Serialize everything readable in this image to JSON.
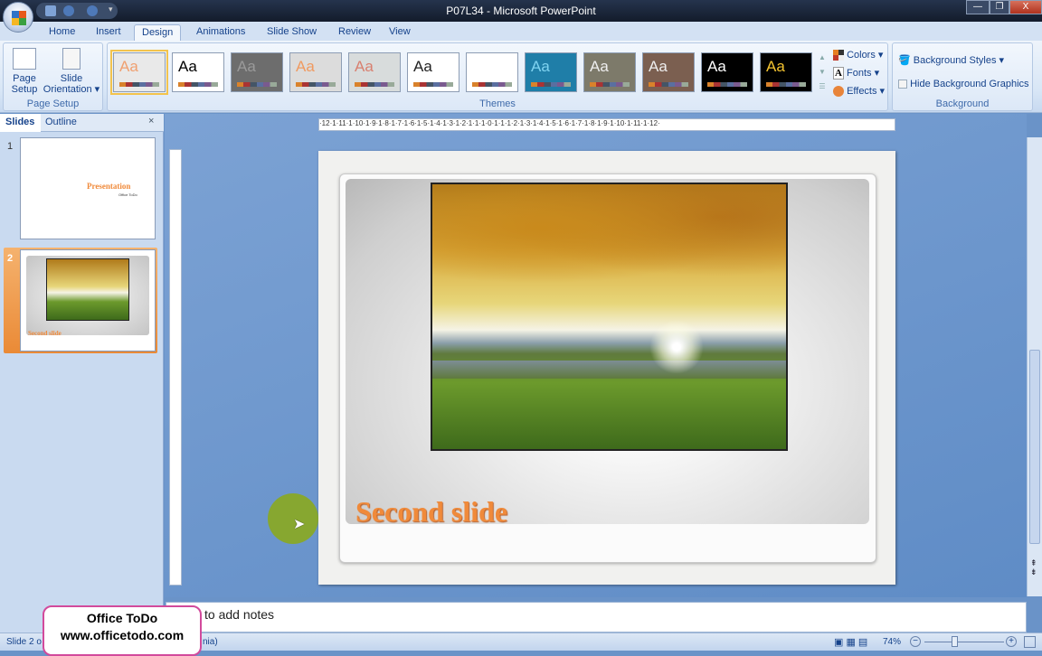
{
  "window": {
    "title": "P07L34 - Microsoft PowerPoint",
    "minimize": "—",
    "restore": "❐",
    "close": "X"
  },
  "tabs": [
    {
      "label": "Home"
    },
    {
      "label": "Insert"
    },
    {
      "label": "Design",
      "active": true
    },
    {
      "label": "Animations"
    },
    {
      "label": "Slide Show"
    },
    {
      "label": "Review"
    },
    {
      "label": "View"
    }
  ],
  "ribbon": {
    "page_setup": {
      "page_setup_label": "Page Setup",
      "slide_orientation_label": "Slide Orientation",
      "group_label": "Page Setup"
    },
    "themes": {
      "group_label": "Themes",
      "items": [
        {
          "aa": "Aa",
          "bg": "#e9e9e9",
          "fg": "#f0a070"
        },
        {
          "aa": "Aa",
          "bg": "#ffffff",
          "fg": "#000"
        },
        {
          "aa": "Aa",
          "bg": "#6d6d6d",
          "fg": "#9a9a9a"
        },
        {
          "aa": "Aa",
          "bg": "#dcdcdc",
          "fg": "#f09a60"
        },
        {
          "aa": "Aa",
          "bg": "#d8dcdc",
          "fg": "#d88070"
        },
        {
          "aa": "Aa",
          "bg": "#ffffff",
          "fg": "#222"
        },
        {
          "aa": "Aa",
          "bg": "#ffffff",
          "fg": "#fff"
        },
        {
          "aa": "Aa",
          "bg": "#1f7ea8",
          "fg": "#7fd3f0"
        },
        {
          "aa": "Aa",
          "bg": "#7d7a6a",
          "fg": "#eee"
        },
        {
          "aa": "Aa",
          "bg": "#7b5f50",
          "fg": "#eee"
        },
        {
          "aa": "Aa",
          "bg": "#000000",
          "fg": "#fff"
        },
        {
          "aa": "Aa",
          "bg": "#000000",
          "fg": "#f4c430"
        }
      ],
      "colors_label": "Colors",
      "fonts_label": "Fonts",
      "effects_label": "Effects"
    },
    "background": {
      "group_label": "Background",
      "background_styles_label": "Background Styles",
      "hide_graphics_label": "Hide Background Graphics",
      "hide_graphics_checked": false
    }
  },
  "panel": {
    "tab_slides": "Slides",
    "tab_outline": "Outline",
    "close": "×",
    "slides": [
      {
        "number": "1",
        "title": "Presentation",
        "subtitle": "Office ToDo"
      },
      {
        "number": "2",
        "title": "Second slide",
        "selected": true
      }
    ]
  },
  "ruler": {
    "h_ticks": "·12·1·11·1·10·1·9·1·8·1·7·1·6·1·5·1·4·1·3·1·2·1·1·1·0·1·1·1·2·1·3·1·4·1·5·1·6·1·7·1·8·1·9·1·10·1·11·1·12·"
  },
  "slide": {
    "title": "Second slide"
  },
  "notes": {
    "placeholder": "Click to add notes",
    "visible_text": "to add notes"
  },
  "status": {
    "slide_info": "Slide 2 o",
    "theme_info": "nia)",
    "zoom": "74%",
    "zoom_fraction": 0.37
  },
  "watermark": {
    "line1": "Office ToDo",
    "line2": "www.officetodo.com"
  }
}
